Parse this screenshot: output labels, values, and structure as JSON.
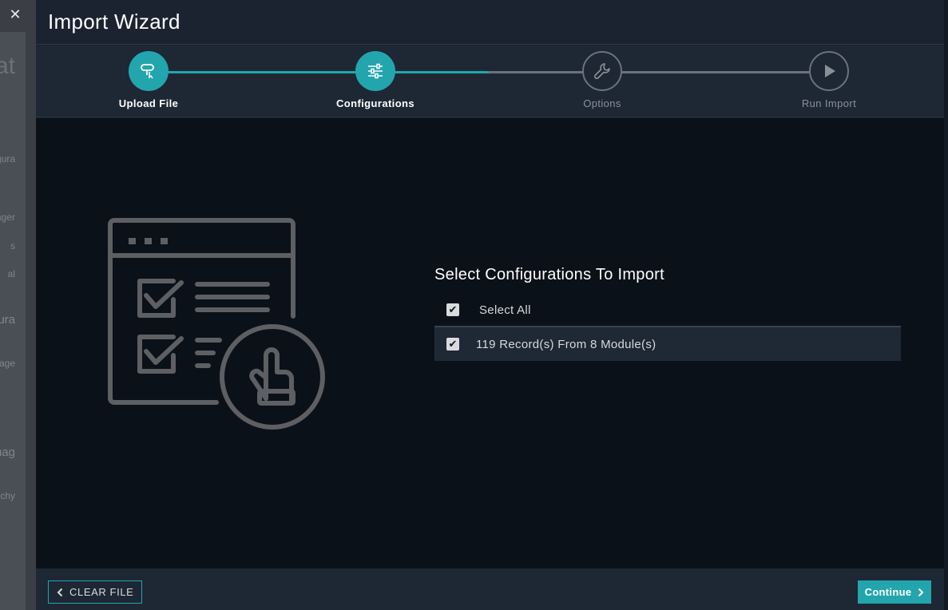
{
  "background": {
    "close_icon": "close-icon",
    "fragments": [
      "cat",
      "igura",
      "ager",
      "s",
      "al",
      "igura",
      "age",
      "anag",
      "chy"
    ]
  },
  "modal": {
    "title": "Import Wizard"
  },
  "steps": [
    {
      "label": "Upload File",
      "icon": "upload-file-icon",
      "state": "done"
    },
    {
      "label": "Configurations",
      "icon": "sliders-icon",
      "state": "current"
    },
    {
      "label": "Options",
      "icon": "wrench-icon",
      "state": "todo"
    },
    {
      "label": "Run Import",
      "icon": "play-icon",
      "state": "todo"
    }
  ],
  "select": {
    "title": "Select Configurations To Import",
    "select_all_label": "Select All",
    "select_all_checked": true,
    "items": [
      {
        "label": "119 Record(s) From 8 Module(s)",
        "checked": true
      }
    ]
  },
  "footer": {
    "clear_label": "CLEAR FILE",
    "continue_label": "Continue"
  },
  "colors": {
    "accent": "#23a5ad",
    "background": "#1b2330",
    "content_bg": "#0b1118"
  }
}
